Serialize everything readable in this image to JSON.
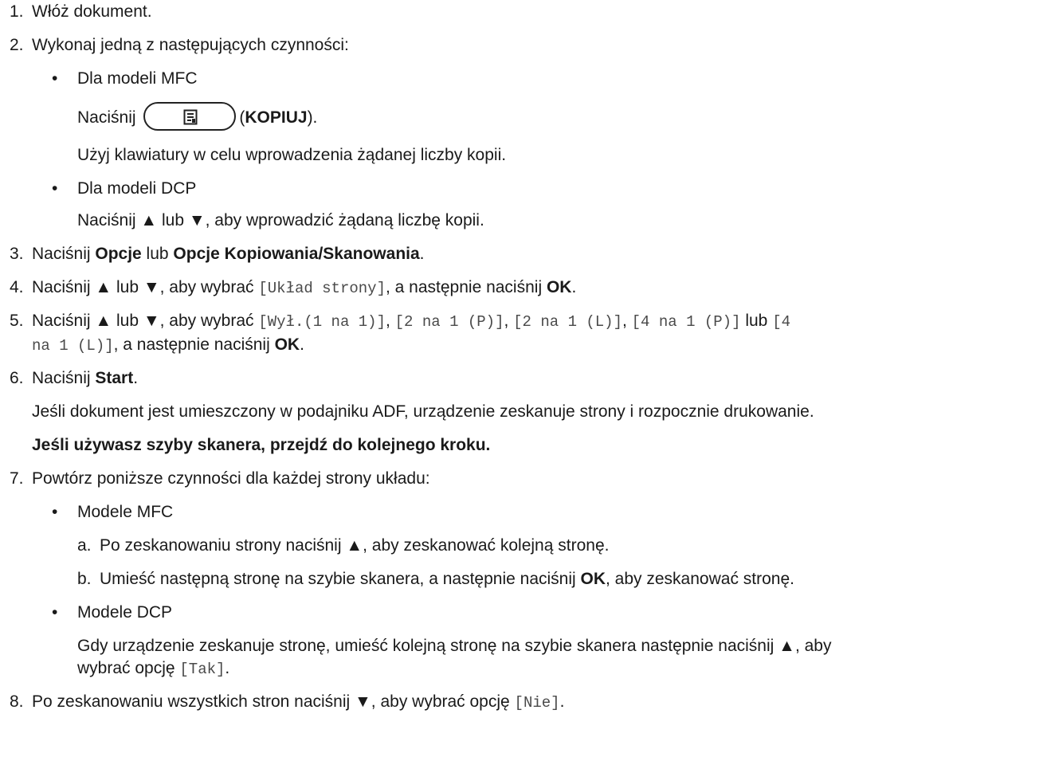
{
  "steps": {
    "s1": {
      "num": "1.",
      "text": "Włóż dokument."
    },
    "s2": {
      "num": "2.",
      "text": "Wykonaj jedną z następujących czynności:"
    },
    "s2_mfc": {
      "bullet": "•",
      "title": "Dla modeli MFC",
      "press": "Naciśnij",
      "key_open": "(",
      "key": "KOPIUJ",
      "key_close": ").",
      "text2": "Użyj klawiatury w celu wprowadzenia żądanej liczby kopii."
    },
    "s2_dcp": {
      "bullet": "•",
      "title": "Dla modeli DCP",
      "text_a": "Naciśnij ▲ lub ▼, aby wprowadzić żądaną liczbę kopii."
    },
    "s3": {
      "num": "3.",
      "t1": "Naciśnij ",
      "b1": "Opcje",
      "t2": " lub ",
      "b2": "Opcje Kopiowania/Skanowania",
      "t3": "."
    },
    "s4": {
      "num": "4.",
      "t1": "Naciśnij ▲ lub ▼, aby wybrać ",
      "m1": "[Układ strony]",
      "t2": ", a następnie naciśnij ",
      "b1": "OK",
      "t3": "."
    },
    "s5": {
      "num": "5.",
      "t1": "Naciśnij ▲ lub ▼, aby wybrać ",
      "m1": "[Wył.(1 na 1)]",
      "c1": ", ",
      "m2": "[2 na 1 (P)]",
      "c2": ", ",
      "m3": "[2 na 1 (L)]",
      "c3": ", ",
      "m4": "[4 na 1 (P)]",
      "t2": " lub ",
      "m5a": "[4",
      "m5b": "na 1 (L)]",
      "t3": ", a następnie naciśnij ",
      "b1": "OK",
      "t4": "."
    },
    "s6": {
      "num": "6.",
      "t1": "Naciśnij ",
      "b1": "Start",
      "t2": ".",
      "p1": "Jeśli dokument jest umieszczony w podajniku ADF, urządzenie zeskanuje strony i rozpocznie drukowanie.",
      "p2": "Jeśli używasz szyby skanera, przejdź do kolejnego kroku."
    },
    "s7": {
      "num": "7.",
      "text": "Powtórz poniższe czynności dla każdej strony układu:",
      "mfc_bullet": "•",
      "mfc_title": "Modele MFC",
      "a_label": "a.",
      "a_text": "Po zeskanowaniu strony naciśnij ▲, aby zeskanować kolejną stronę.",
      "b_label": "b.",
      "b_t1": "Umieść następną stronę na szybie skanera, a następnie naciśnij ",
      "b_b1": "OK",
      "b_t2": ", aby zeskanować stronę.",
      "dcp_bullet": "•",
      "dcp_title": "Modele DCP",
      "dcp_t1": "Gdy urządzenie zeskanuje stronę, umieść kolejną stronę na szybie skanera następnie naciśnij ▲, aby",
      "dcp_t2": "wybrać opcję ",
      "dcp_m1": "[Tak]",
      "dcp_t3": "."
    },
    "s8": {
      "num": "8.",
      "t1": "Po zeskanowaniu wszystkich stron naciśnij ▼, aby wybrać opcję ",
      "m1": "[Nie]",
      "t2": "."
    }
  },
  "icons": {
    "copy_key": "copy-document-icon"
  }
}
